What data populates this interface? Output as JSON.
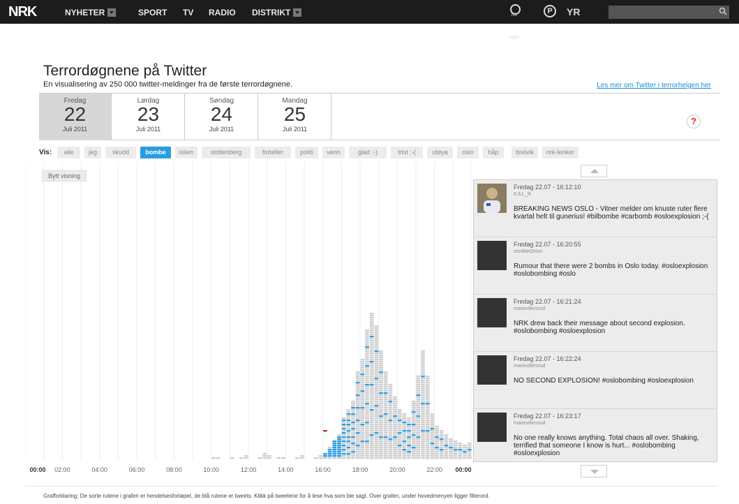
{
  "nav": {
    "logo": "NRK",
    "items": [
      {
        "label": "NYHETER",
        "has_arrow": true
      },
      {
        "label": "SPORT",
        "has_arrow": false
      },
      {
        "label": "TV",
        "has_arrow": false
      },
      {
        "label": "RADIO",
        "has_arrow": false
      },
      {
        "label": "DISTRIKT",
        "has_arrow": true
      }
    ],
    "nrksuper_label": "nrk super",
    "p3_label": "P",
    "yr_label": "YR",
    "search_placeholder": "",
    "search_icon": "search-icon"
  },
  "header": {
    "title": "Terrordøgnene på Twitter",
    "subtitle": "En visualisering av 250 000 twitter-meldinger fra de første terrordøgnene.",
    "read_more": "Les mer om Twitter i terrorhelgen her"
  },
  "days": [
    {
      "name": "Fredag",
      "num": "22",
      "month": "Juli 2011",
      "active": true
    },
    {
      "name": "Lørdag",
      "num": "23",
      "month": "Juli 2011",
      "active": false
    },
    {
      "name": "Søndag",
      "num": "24",
      "month": "Juli 2011",
      "active": false
    },
    {
      "name": "Mandag",
      "num": "25",
      "month": "Juli 2011",
      "active": false
    }
  ],
  "help_label": "?",
  "filters": {
    "label": "Vis:",
    "items": [
      "alle",
      "jeg",
      "skudd",
      "bombe",
      "islam",
      "stoltenberg",
      "forteller",
      "politi",
      "venn",
      "glad :-)",
      "trist :-(",
      "utøya",
      "oslo",
      "håp",
      "breivik",
      "nrk-lenker"
    ],
    "active": "bombe"
  },
  "toggle_view_label": "Bytt visning",
  "chart_data": {
    "type": "bar",
    "x_label_ticks": [
      "00:00",
      "02:00",
      "04:00",
      "06:00",
      "08:00",
      "10:00",
      "12:00",
      "14:00",
      "16:00",
      "18:00",
      "20:00",
      "22:00",
      "00:00"
    ],
    "bin_minutes": 15,
    "event_counts": [
      0,
      0,
      0,
      0,
      0,
      0,
      0,
      0,
      0,
      0,
      0,
      0,
      0,
      0,
      0,
      0,
      0,
      0,
      0,
      0,
      0,
      0,
      0,
      0,
      0,
      0,
      0,
      0,
      0,
      0,
      0,
      0,
      0,
      0,
      0,
      0,
      0,
      0,
      0,
      0,
      1,
      1,
      0,
      0,
      1,
      0,
      1,
      2,
      0,
      0,
      1,
      3,
      2,
      0,
      1,
      1,
      0,
      0,
      1,
      2,
      0,
      0,
      1,
      2,
      3,
      6,
      9,
      12,
      20,
      24,
      28,
      42,
      48,
      62,
      70,
      64,
      52,
      42,
      36,
      30,
      24,
      22,
      20,
      28,
      40,
      52,
      40,
      22,
      16,
      14,
      12,
      10,
      9,
      8,
      7,
      8
    ],
    "tweet_counts": [
      0,
      0,
      0,
      0,
      0,
      0,
      0,
      0,
      0,
      0,
      0,
      0,
      0,
      0,
      0,
      0,
      0,
      0,
      0,
      0,
      0,
      0,
      0,
      0,
      0,
      0,
      0,
      0,
      0,
      0,
      0,
      0,
      0,
      0,
      0,
      0,
      0,
      0,
      0,
      0,
      0,
      0,
      0,
      0,
      0,
      0,
      0,
      0,
      0,
      0,
      0,
      0,
      0,
      0,
      0,
      0,
      0,
      0,
      0,
      0,
      0,
      0,
      0,
      0,
      2,
      4,
      8,
      10,
      9,
      8,
      7,
      6,
      5,
      6,
      5,
      4,
      4,
      3,
      3,
      2,
      3,
      4,
      5,
      4,
      3,
      3,
      2,
      2,
      2,
      2,
      1,
      1,
      1,
      1,
      1,
      1
    ],
    "colors": {
      "event": "#cfcfcf",
      "tweet": "#2b9ce0",
      "highlight": "#d02a1e"
    },
    "grid": true
  },
  "tweets": [
    {
      "date": "Fredag 22.07 - 16:12:10",
      "user": "KJLL_R",
      "text": "BREAKING NEWS OSLO - Vitner melder om knuste ruter flere kvartal helt til gunerius! #bilbombe #carbomb #osloexplosion ;-(",
      "photo": true
    },
    {
      "date": "Fredag 22.07 - 16:20:55",
      "user": "zombieOnion",
      "text": "Rumour that there were 2 bombs in Oslo today. #osloexplosion #oslobombing #oslo",
      "photo": false
    },
    {
      "date": "Fredag 22.07 - 16:21:24",
      "user": "marievillersrud",
      "text": "NRK drew back their message about second explosion. #oslobombing #osloexplosion",
      "photo": false
    },
    {
      "date": "Fredag 22.07 - 16:22:24",
      "user": "marievillersrud",
      "text": "NO SECOND EXPLOSION! #oslobombing #osloexplosion",
      "photo": false
    },
    {
      "date": "Fredag 22.07 - 16:23:17",
      "user": "marievillersrud",
      "text": "No one really knows anything. Total chaos all over. Shaking, terrified that someone I know is hurt... #oslobombing #osloexplosion",
      "photo": false
    }
  ],
  "footer": "Grafforklaring: De sorte rutene i grafen er hendelsesforløpet, de blå rutene er tweets.  Klikk på tweetene for å lese hva som ble sagt.  Over grafen, under hovedmenyen ligger filterord."
}
